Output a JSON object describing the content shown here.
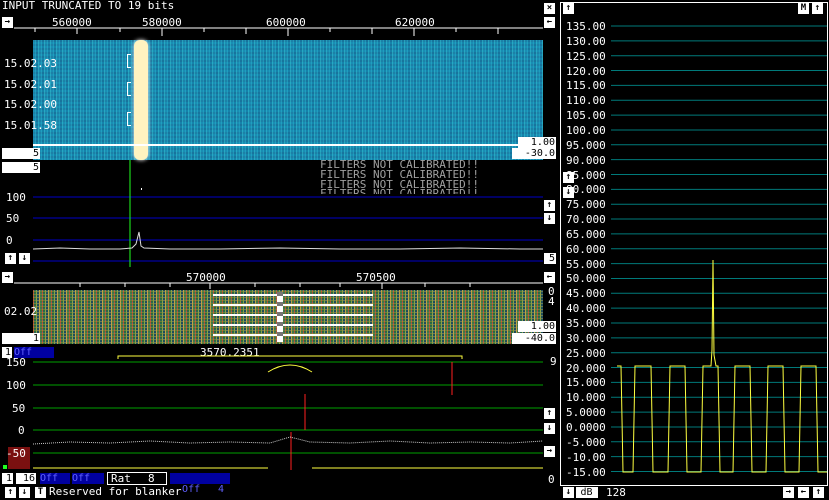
{
  "title_bar": "INPUT TRUNCATED TO 19 bits",
  "main_waterfall": {
    "freq_labels": [
      "560000",
      "580000",
      "600000",
      "620000"
    ],
    "time_labels": [
      "15.02.03",
      "15.02.01",
      "15.02.00",
      "15.01.58"
    ],
    "gain_value": "1.00",
    "offset_value": "-30.0",
    "avg_value": "5"
  },
  "main_spectrum": {
    "top_box": "5",
    "y_labels": [
      "100",
      "50",
      "0"
    ],
    "bottom_box": "5",
    "warnings": [
      "FILTERS NOT CALIBRATED!!",
      "FILTERS NOT CALIBRATED!!",
      "FILTERS NOT CALIBRATED!!",
      "FILTERS NOT CALIBRATED!!"
    ]
  },
  "hires_waterfall": {
    "freq_labels": [
      "570000",
      "570500"
    ],
    "time_label": "02.02",
    "side_labels": [
      "0",
      "4"
    ],
    "gain_value": "1.00",
    "offset_value": "-40.0",
    "avg_value": "1"
  },
  "baseband": {
    "left_box": "1",
    "off_label": "Off",
    "frequency": "3570.2351",
    "y_labels": [
      "150",
      "100",
      "50",
      "0",
      "-50"
    ],
    "right_top": "9",
    "right_bottom": "0"
  },
  "bottom_bar": {
    "box_1": "1",
    "box_16": "16",
    "off_1": "Off",
    "off_2": "Off",
    "rat_label": "Rat",
    "rat_value": "8",
    "off_3": "Off",
    "off_3_value": "4",
    "reserved": "Reserved for blanker"
  },
  "right_panel": {
    "top_btn": "↑",
    "m_btn": "M",
    "y_labels": [
      "135.00",
      "130.00",
      "125.00",
      "120.00",
      "115.00",
      "110.00",
      "105.00",
      "100.00",
      "95.000",
      "90.000",
      "85.000",
      "80.000",
      "75.000",
      "70.000",
      "65.000",
      "60.000",
      "55.000",
      "50.000",
      "45.000",
      "40.000",
      "35.000",
      "30.000",
      "25.000",
      "20.000",
      "15.000",
      "10.000",
      "5.0000",
      "0.0000",
      "-5.000",
      "-10.00",
      "-15.00"
    ],
    "db_label": "dB",
    "db_value": "128"
  },
  "colors": {
    "grid_blue": "#0000c8",
    "grid_green": "#00a000",
    "trace_yellow": "#ffff40",
    "marker_red": "#ff2020",
    "waterfall_bg": "#0c5a7a"
  }
}
